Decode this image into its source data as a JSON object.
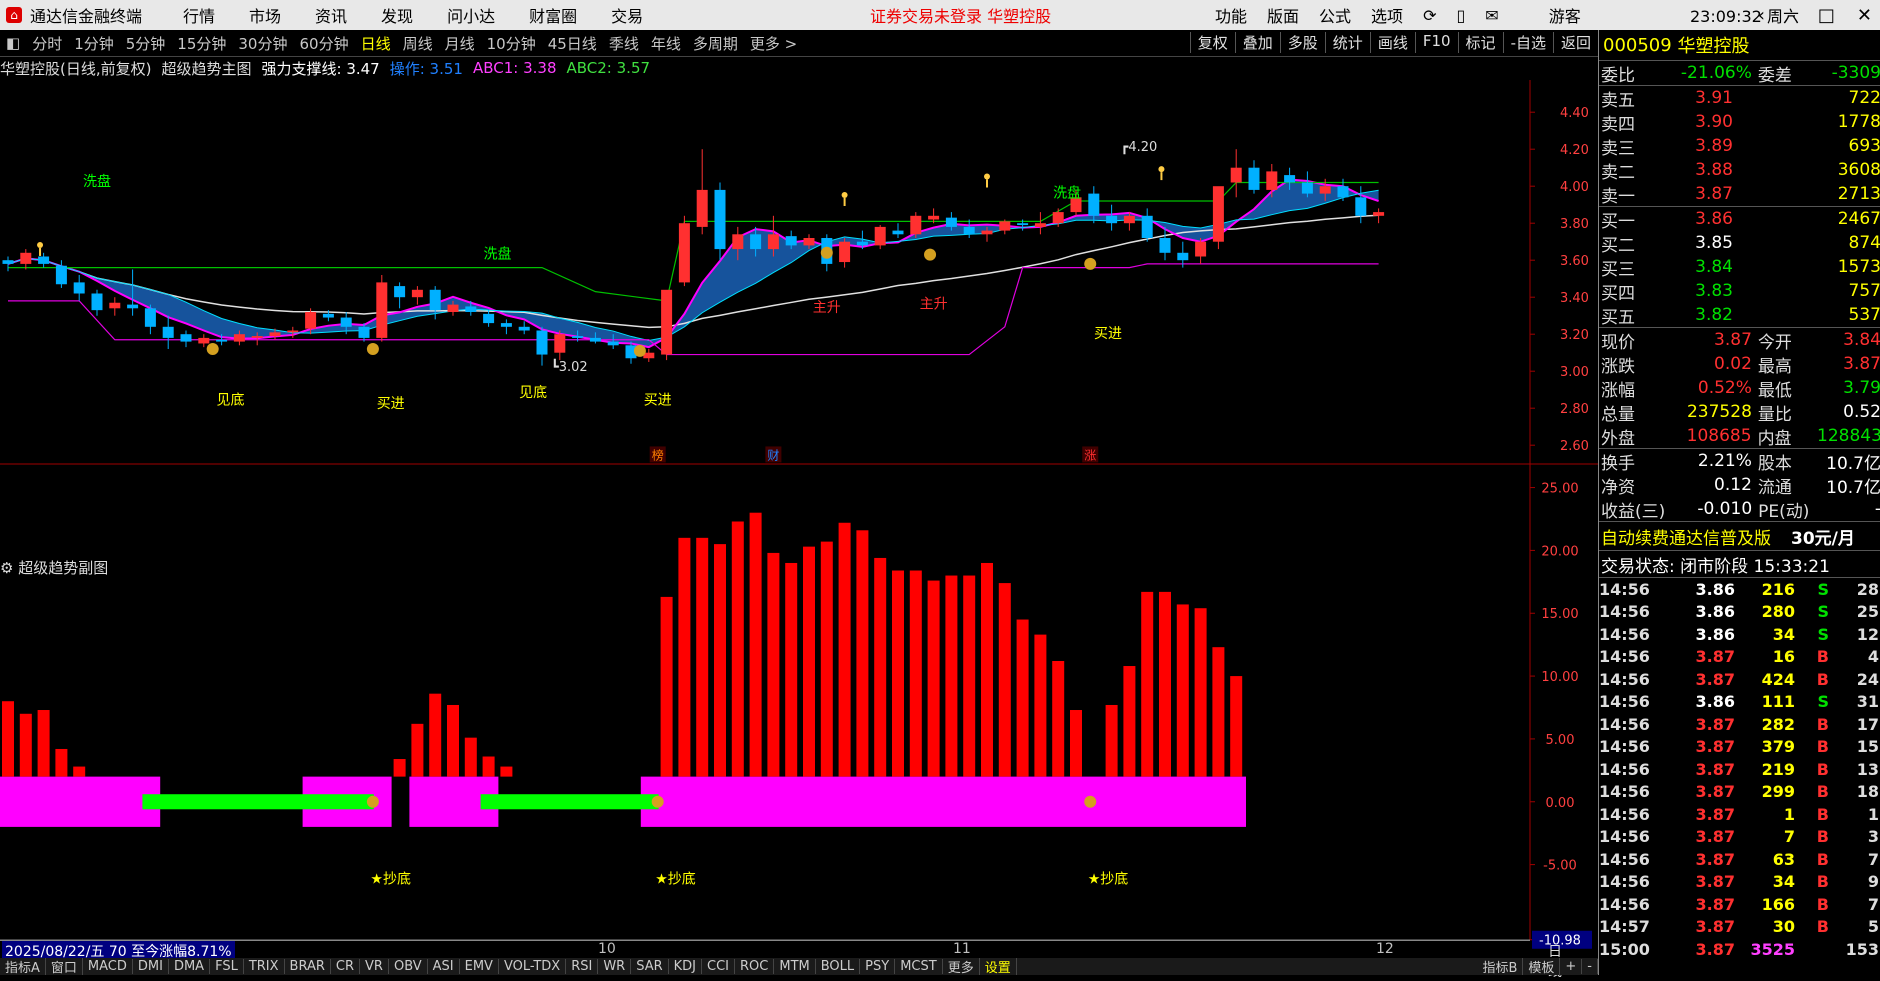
{
  "menubar": {
    "app_title": "通达信金融终端",
    "menus": [
      "行情",
      "市场",
      "资讯",
      "发现",
      "问小达",
      "财富圈",
      "交易"
    ],
    "warning": "证券交易未登录  华塑控股",
    "tools": [
      "功能",
      "版面",
      "公式",
      "选项"
    ],
    "user": "游客",
    "clock": "23:09:32 周六"
  },
  "toolbar": {
    "periods": [
      "分时",
      "1分钟",
      "5分钟",
      "15分钟",
      "30分钟",
      "60分钟",
      "日线",
      "周线",
      "月线",
      "10分钟",
      "45日线",
      "季线",
      "年线",
      "多周期",
      "更多 >"
    ],
    "active_period": "日线",
    "right_buttons": [
      "复权",
      "叠加",
      "多股",
      "统计",
      "画线",
      "F10",
      "标记",
      "-自选",
      "返回"
    ]
  },
  "chart_header": {
    "stock": "华塑控股(日线,前复权)",
    "indicator": "超级趋势主图",
    "support": "强力支撑线: 3.47",
    "op": "操作: 3.51",
    "abc1": "ABC1: 3.38",
    "abc2": "ABC2: 3.57",
    "sub_indicator": "超级趋势副图"
  },
  "chart_data": [
    {
      "type": "candlestick",
      "title": "超级趋势主图",
      "y_ticks": [
        "4.40",
        "4.20",
        "4.00",
        "3.80",
        "3.60",
        "3.40",
        "3.20",
        "3.00",
        "2.80",
        "2.60"
      ],
      "ylim": [
        2.52,
        4.52
      ],
      "ohlc": [
        [
          3.6,
          3.62,
          3.54,
          3.58
        ],
        [
          3.58,
          3.66,
          3.55,
          3.64
        ],
        [
          3.62,
          3.64,
          3.56,
          3.58
        ],
        [
          3.57,
          3.6,
          3.45,
          3.47
        ],
        [
          3.48,
          3.52,
          3.38,
          3.42
        ],
        [
          3.42,
          3.44,
          3.3,
          3.33
        ],
        [
          3.34,
          3.4,
          3.3,
          3.37
        ],
        [
          3.36,
          3.55,
          3.3,
          3.34
        ],
        [
          3.34,
          3.36,
          3.2,
          3.24
        ],
        [
          3.24,
          3.3,
          3.12,
          3.18
        ],
        [
          3.2,
          3.22,
          3.13,
          3.16
        ],
        [
          3.15,
          3.2,
          3.13,
          3.18
        ],
        [
          3.17,
          3.2,
          3.14,
          3.16
        ],
        [
          3.16,
          3.22,
          3.14,
          3.2
        ],
        [
          3.18,
          3.21,
          3.14,
          3.19
        ],
        [
          3.19,
          3.23,
          3.17,
          3.21
        ],
        [
          3.21,
          3.24,
          3.18,
          3.22
        ],
        [
          3.23,
          3.34,
          3.2,
          3.32
        ],
        [
          3.31,
          3.33,
          3.27,
          3.29
        ],
        [
          3.29,
          3.32,
          3.2,
          3.24
        ],
        [
          3.24,
          3.26,
          3.16,
          3.18
        ],
        [
          3.18,
          3.52,
          3.16,
          3.48
        ],
        [
          3.46,
          3.48,
          3.34,
          3.4
        ],
        [
          3.4,
          3.46,
          3.36,
          3.44
        ],
        [
          3.44,
          3.46,
          3.28,
          3.33
        ],
        [
          3.32,
          3.38,
          3.3,
          3.36
        ],
        [
          3.35,
          3.38,
          3.3,
          3.32
        ],
        [
          3.31,
          3.33,
          3.24,
          3.26
        ],
        [
          3.26,
          3.28,
          3.2,
          3.24
        ],
        [
          3.24,
          3.27,
          3.2,
          3.22
        ],
        [
          3.22,
          3.24,
          3.03,
          3.09
        ],
        [
          3.1,
          3.22,
          3.06,
          3.2
        ],
        [
          3.19,
          3.22,
          3.16,
          3.18
        ],
        [
          3.18,
          3.21,
          3.15,
          3.16
        ],
        [
          3.16,
          3.2,
          3.12,
          3.14
        ],
        [
          3.14,
          3.16,
          3.04,
          3.07
        ],
        [
          3.07,
          3.12,
          3.05,
          3.1
        ],
        [
          3.09,
          3.2,
          3.06,
          3.44
        ],
        [
          3.48,
          3.84,
          3.46,
          3.8
        ],
        [
          3.78,
          4.2,
          3.74,
          3.98
        ],
        [
          3.98,
          4.02,
          3.6,
          3.66
        ],
        [
          3.66,
          3.78,
          3.6,
          3.74
        ],
        [
          3.74,
          3.78,
          3.62,
          3.66
        ],
        [
          3.66,
          3.84,
          3.62,
          3.74
        ],
        [
          3.73,
          3.76,
          3.66,
          3.68
        ],
        [
          3.68,
          3.74,
          3.66,
          3.72
        ],
        [
          3.72,
          3.74,
          3.54,
          3.58
        ],
        [
          3.59,
          3.72,
          3.56,
          3.7
        ],
        [
          3.7,
          3.76,
          3.66,
          3.68
        ],
        [
          3.68,
          3.79,
          3.66,
          3.78
        ],
        [
          3.76,
          3.8,
          3.72,
          3.74
        ],
        [
          3.74,
          3.86,
          3.72,
          3.84
        ],
        [
          3.82,
          3.88,
          3.8,
          3.84
        ],
        [
          3.83,
          3.86,
          3.76,
          3.78
        ],
        [
          3.78,
          3.82,
          3.72,
          3.74
        ],
        [
          3.74,
          3.78,
          3.7,
          3.76
        ],
        [
          3.76,
          3.82,
          3.74,
          3.81
        ],
        [
          3.8,
          3.82,
          3.76,
          3.79
        ],
        [
          3.78,
          3.86,
          3.74,
          3.8
        ],
        [
          3.8,
          3.88,
          3.78,
          3.86
        ],
        [
          3.86,
          3.98,
          3.84,
          3.94
        ],
        [
          3.96,
          4.0,
          3.8,
          3.84
        ],
        [
          3.84,
          3.9,
          3.76,
          3.8
        ],
        [
          3.8,
          3.86,
          3.76,
          3.84
        ],
        [
          3.84,
          3.88,
          3.7,
          3.72
        ],
        [
          3.72,
          3.78,
          3.6,
          3.64
        ],
        [
          3.64,
          3.7,
          3.56,
          3.6
        ],
        [
          3.62,
          3.72,
          3.58,
          3.7
        ],
        [
          3.7,
          3.82,
          3.66,
          4.0
        ],
        [
          4.02,
          4.2,
          3.94,
          4.1
        ],
        [
          4.1,
          4.14,
          3.96,
          3.98
        ],
        [
          3.98,
          4.12,
          3.94,
          4.08
        ],
        [
          4.06,
          4.1,
          3.98,
          4.02
        ],
        [
          4.02,
          4.08,
          3.94,
          3.96
        ],
        [
          3.96,
          4.04,
          3.92,
          4.0
        ],
        [
          4.0,
          4.04,
          3.92,
          3.94
        ],
        [
          3.94,
          4.0,
          3.8,
          3.84
        ],
        [
          3.84,
          3.88,
          3.8,
          3.86
        ]
      ],
      "annotations": [
        "洗盘",
        "洗盘",
        "洗盘",
        "见底",
        "买进",
        "见底",
        "买进",
        "主升",
        "主升",
        "买进",
        "3.02",
        "4.20",
        "榜",
        "财",
        "涨"
      ]
    },
    {
      "type": "bar",
      "title": "超级趋势副图",
      "y_ticks": [
        "25.00",
        "20.00",
        "15.00",
        "10.00",
        "5.00",
        "0.00",
        "-5.00",
        "-10.98"
      ],
      "ylim": [
        -11,
        26
      ],
      "red_bars": [
        [
          0,
          8
        ],
        [
          1,
          7
        ],
        [
          2,
          7.3
        ],
        [
          3,
          4.2
        ],
        [
          4,
          2.8
        ],
        [
          5,
          1
        ],
        [
          22,
          3.4
        ],
        [
          23,
          6.2
        ],
        [
          24,
          8.6
        ],
        [
          25,
          7.7
        ],
        [
          26,
          5.1
        ],
        [
          27,
          3.6
        ],
        [
          28,
          2.8
        ],
        [
          37,
          16.3
        ],
        [
          38,
          21
        ],
        [
          39,
          21
        ],
        [
          40,
          20.5
        ],
        [
          41,
          22.3
        ],
        [
          42,
          23
        ],
        [
          43,
          19.8
        ],
        [
          44,
          19
        ],
        [
          45,
          20.3
        ],
        [
          46,
          20.7
        ],
        [
          47,
          22.2
        ],
        [
          48,
          21.6
        ],
        [
          49,
          19.4
        ],
        [
          50,
          18.4
        ],
        [
          51,
          18.4
        ],
        [
          52,
          17.6
        ],
        [
          53,
          18
        ],
        [
          54,
          18
        ],
        [
          55,
          19
        ],
        [
          56,
          17.4
        ],
        [
          57,
          14.5
        ],
        [
          58,
          13.3
        ],
        [
          59,
          11.2
        ],
        [
          60,
          7.3
        ],
        [
          62,
          7.7
        ],
        [
          63,
          10.8
        ],
        [
          64,
          16.7
        ],
        [
          65,
          16.7
        ],
        [
          66,
          15.7
        ],
        [
          67,
          15.4
        ],
        [
          68,
          12.3
        ],
        [
          69,
          10
        ]
      ],
      "magenta_blocks": [
        [
          0,
          9
        ],
        [
          17,
          22
        ],
        [
          23,
          28
        ],
        [
          36,
          70
        ]
      ],
      "green_bands": [
        [
          8,
          21
        ],
        [
          27,
          37
        ]
      ],
      "labels": [
        "★抄底",
        "★抄底",
        "★抄底"
      ]
    }
  ],
  "x_axis": {
    "labels": [
      "10",
      "11",
      "12"
    ],
    "right_label": "日线"
  },
  "date_info": "2025/08/22/五  70 至今涨幅8.71%",
  "bottom_tabs": [
    "指标A",
    "窗口",
    "MACD",
    "DMI",
    "DMA",
    "FSL",
    "TRIX",
    "BRAR",
    "CR",
    "VR",
    "OBV",
    "ASI",
    "EMV",
    "VOL-TDX",
    "RSI",
    "WR",
    "SAR",
    "KDJ",
    "CCI",
    "ROC",
    "MTM",
    "BOLL",
    "PSY",
    "MCST",
    "更多",
    "设置",
    "指标B",
    "模板",
    "+",
    "-"
  ],
  "right_panel": {
    "code": "000509",
    "name": "华塑控股",
    "ratio_label": "委比",
    "ratio": "-21.06%",
    "diff_label": "委差",
    "diff": "-3309",
    "asks": [
      [
        "卖五",
        "3.91",
        "722"
      ],
      [
        "卖四",
        "3.90",
        "1778"
      ],
      [
        "卖三",
        "3.89",
        "693"
      ],
      [
        "卖二",
        "3.88",
        "3608"
      ],
      [
        "卖一",
        "3.87",
        "2713"
      ]
    ],
    "bids": [
      [
        "买一",
        "3.86",
        "2467"
      ],
      [
        "买二",
        "3.85",
        "874"
      ],
      [
        "买三",
        "3.84",
        "1573"
      ],
      [
        "买四",
        "3.83",
        "757"
      ],
      [
        "买五",
        "3.82",
        "537"
      ]
    ],
    "stats": [
      [
        "现价",
        "3.87",
        "今开",
        "3.84"
      ],
      [
        "涨跌",
        "0.02",
        "最高",
        "3.87"
      ],
      [
        "涨幅",
        "0.52%",
        "最低",
        "3.79"
      ],
      [
        "总量",
        "237528",
        "量比",
        "0.52"
      ],
      [
        "外盘",
        "108685",
        "内盘",
        "128843"
      ]
    ],
    "stats2": [
      [
        "换手",
        "2.21%",
        "股本",
        "10.7亿"
      ],
      [
        "净资",
        "0.12",
        "流通",
        "10.7亿"
      ],
      [
        "收益(三)",
        "-0.010",
        "PE(动)",
        "-"
      ]
    ],
    "ad": "自动续费通达信普及版",
    "ad_price": "30元/月",
    "status": "交易状态: 闭市阶段 15:33:21",
    "ticks": [
      [
        "14:56",
        "3.86",
        "216",
        "S",
        "28"
      ],
      [
        "14:56",
        "3.86",
        "280",
        "S",
        "25"
      ],
      [
        "14:56",
        "3.86",
        "34",
        "S",
        "12"
      ],
      [
        "14:56",
        "3.87",
        "16",
        "B",
        "4"
      ],
      [
        "14:56",
        "3.87",
        "424",
        "B",
        "24"
      ],
      [
        "14:56",
        "3.86",
        "111",
        "S",
        "31"
      ],
      [
        "14:56",
        "3.87",
        "282",
        "B",
        "17"
      ],
      [
        "14:56",
        "3.87",
        "379",
        "B",
        "15"
      ],
      [
        "14:56",
        "3.87",
        "219",
        "B",
        "13"
      ],
      [
        "14:56",
        "3.87",
        "299",
        "B",
        "18"
      ],
      [
        "14:56",
        "3.87",
        "1",
        "B",
        "1"
      ],
      [
        "14:56",
        "3.87",
        "7",
        "B",
        "3"
      ],
      [
        "14:56",
        "3.87",
        "63",
        "B",
        "7"
      ],
      [
        "14:56",
        "3.87",
        "34",
        "B",
        "9"
      ],
      [
        "14:56",
        "3.87",
        "166",
        "B",
        "7"
      ],
      [
        "14:57",
        "3.87",
        "30",
        "B",
        "5"
      ],
      [
        "15:00",
        "3.87",
        "3525",
        "",
        "153"
      ]
    ]
  },
  "colors": {
    "up": "#ff3030",
    "down": "#00b0ff",
    "ma_white": "#e0e0e0",
    "ma_green": "#00c000",
    "ma_magenta": "#e000e0",
    "yellow": "#ffff00",
    "magenta": "#ff00ff",
    "green": "#00ff00"
  }
}
